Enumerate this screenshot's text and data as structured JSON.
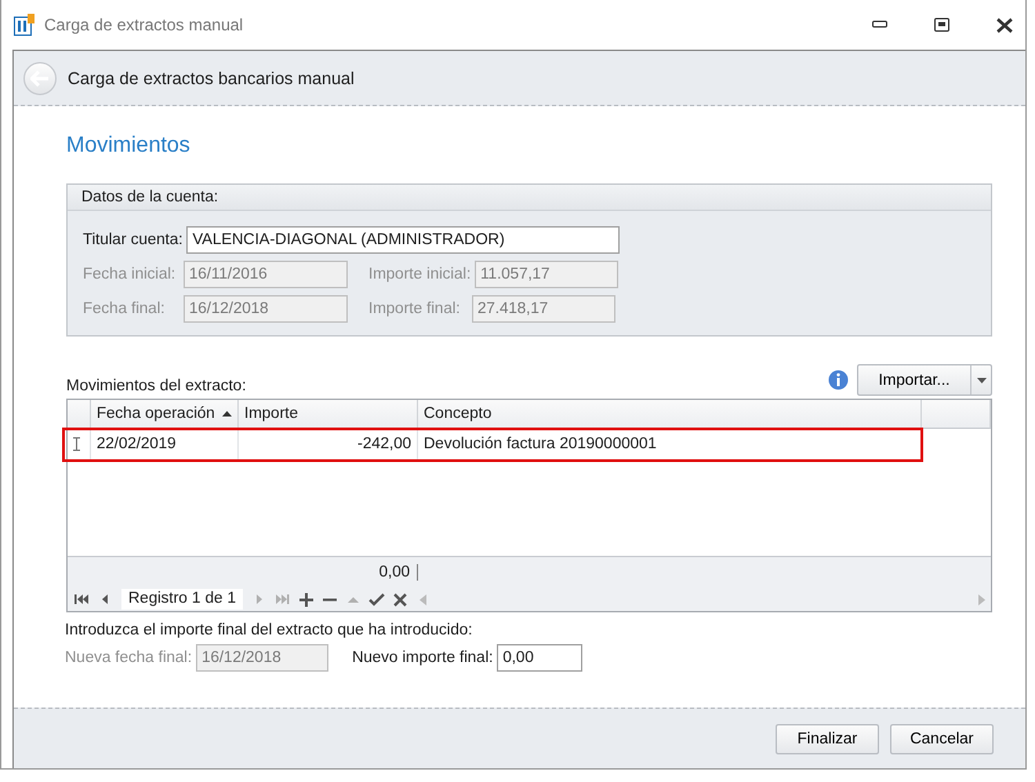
{
  "window": {
    "title": "Carga de extractos manual"
  },
  "header": {
    "title": "Carga de extractos bancarios manual"
  },
  "section_title": "Movimientos",
  "account": {
    "title": "Datos de la cuenta:",
    "holder": {
      "label": "Titular cuenta:",
      "value": "VALENCIA-DIAGONAL (ADMINISTRADOR)",
      "disabled": false
    },
    "rows": [
      [
        {
          "label": "Fecha inicial:",
          "value": "16/11/2016",
          "disabled": true
        },
        {
          "label": "Importe inicial:",
          "value": "11.057,17",
          "disabled": true
        }
      ],
      [
        {
          "label": "Fecha final:",
          "value": "16/12/2018",
          "disabled": true
        },
        {
          "label": "Importe final:",
          "value": "27.418,17",
          "disabled": true
        }
      ]
    ]
  },
  "movements": {
    "label": "Movimientos del extracto:",
    "import_button": "Importar...",
    "columns": [
      {
        "label": "Fecha operación",
        "sorted": true
      },
      {
        "label": "Importe",
        "sorted": false
      },
      {
        "label": "Concepto",
        "sorted": false
      }
    ],
    "rows": [
      {
        "cells": [
          "22/02/2019",
          "-242,00",
          "Devolución factura 20190000001"
        ],
        "highlighted": true
      }
    ],
    "total": "0,00",
    "navigator": {
      "text": "Registro 1 de 1",
      "buttons": [
        {
          "kind": "first",
          "disabled": false
        },
        {
          "kind": "prev",
          "disabled": false
        }
      ],
      "buttons_after": [
        {
          "kind": "next",
          "disabled": true
        },
        {
          "kind": "last",
          "disabled": true
        },
        {
          "kind": "add",
          "disabled": false
        },
        {
          "kind": "remove",
          "disabled": false
        },
        {
          "kind": "up",
          "disabled": true
        },
        {
          "kind": "check",
          "disabled": false
        },
        {
          "kind": "cancel",
          "disabled": false
        }
      ]
    }
  },
  "final": {
    "instruction": "Introduzca el importe final del extracto que ha introducido:",
    "fields": [
      {
        "label": "Nueva fecha final:",
        "value": "16/12/2018",
        "disabled": true
      },
      {
        "label": "Nuevo importe final:",
        "value": "0,00",
        "disabled": false
      }
    ]
  },
  "buttons": [
    "Finalizar",
    "Cancelar"
  ]
}
